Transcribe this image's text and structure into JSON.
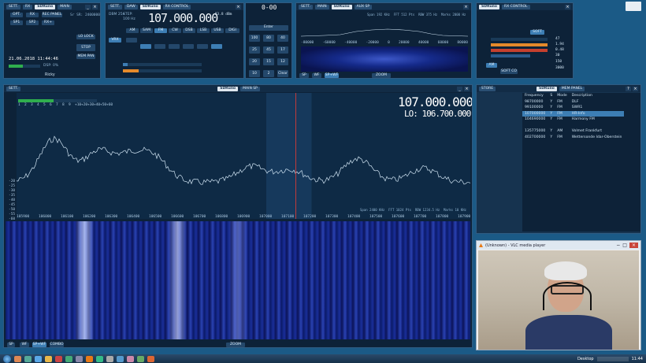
{
  "colors": {
    "desktop": "#1b5a86",
    "panel": "#0d2238",
    "accent": "#3d7eb4",
    "spectrum_trace": "#cfe3f2",
    "selected_row": "#3d7eb4"
  },
  "main_window": {
    "sett": "SETT.",
    "app": "SDRuno",
    "tab": "MAIN",
    "buttons": {
      "opt": "OPT.",
      "rx": "RX",
      "rec_panel": "REC PANEL",
      "sp1": "SP1",
      "sp2": "SP2",
      "rx_add": "RX+"
    },
    "sr": "Sr SR: 2400000",
    "lo_lock": "LO LOCK",
    "stop": "STOP",
    "mem_pan": "MEM PAN",
    "date": "21.06.2018 11:44:46",
    "cpu": "DSP: 0%",
    "user": "Ricky"
  },
  "rx_control": {
    "sett": "SETT.",
    "app": "SDRuno",
    "tab": "RX CONTROL",
    "bw_label": "DBM 25e",
    "step_label": "STEP:",
    "step_val": "100 Hz",
    "freq": "107.000.000",
    "level": "-83.8 dBm",
    "modes": [
      "AM",
      "SAM",
      "FM",
      "CW",
      "DSB",
      "LSB",
      "USB",
      "DIGI"
    ],
    "vrx": "VRX"
  },
  "keypad": {
    "keys": [
      "100",
      "80",
      "40",
      "25",
      "45",
      "17",
      "20",
      "15",
      "12",
      "10",
      "2",
      "Clear"
    ],
    "enter": "Enter",
    "display": "0-00"
  },
  "aux_sp": {
    "sett": "SETT.",
    "tab": "MAIN",
    "app": "SDRuno",
    "title": "AUX SP",
    "span": "Span 192 KHz",
    "fft": "FFT 512 Pts",
    "rbw": "RBW 375 Hz",
    "marks": "Marks 2000 Hz",
    "ticks": [
      "-80000",
      "-60000",
      "-40000",
      "-20000",
      "0",
      "20000",
      "40000",
      "60000",
      "80000"
    ],
    "zoom": "ZOOM",
    "bottom_btns": [
      "SP",
      "WF",
      "SP+WF"
    ]
  },
  "rx_ctrl_small": {
    "app": "SDRuno",
    "title": "RX CONTROL",
    "soft": "SOFT",
    "b1": "AM",
    "b2": "SOFT CO",
    "values": [
      "47",
      "1.94",
      "0.48",
      "30",
      "150",
      "3000"
    ]
  },
  "main_sp": {
    "sett": "SETT.",
    "app": "SDRuno",
    "title": "MAIN SP",
    "freq": "107.000.000",
    "lo": "LO: 106.700.000",
    "db_ticks": [
      "-20",
      "-25",
      "-30",
      "-35",
      "-40",
      "-45",
      "-50",
      "-55",
      "-60",
      "-65",
      "-70",
      "-75",
      "-80",
      "-85",
      "-90",
      "-95",
      "-100",
      "-105",
      "-110",
      "-115",
      "-120",
      "-125",
      "-130",
      "-135",
      "-140"
    ],
    "s_ticks": [
      "1",
      "2",
      "3",
      "4",
      "5",
      "6",
      "7",
      "8",
      "9",
      "+10",
      "+20",
      "+30",
      "+40",
      "+50",
      "+60"
    ],
    "freq_ticks": [
      "105900",
      "106000",
      "106100",
      "106200",
      "106300",
      "106400",
      "106500",
      "106600",
      "106700",
      "106800",
      "106900",
      "107000",
      "107100",
      "107200",
      "107300",
      "107400",
      "107500",
      "107600",
      "107700",
      "107800",
      "107900"
    ],
    "span": "Span 2400 KHz",
    "fft": "FFT 1024 Pts",
    "rbw": "RBW 1234.5 Hz",
    "marks": "Marks 10 KHz",
    "zoom": "ZOOM",
    "bottom_btns": [
      "SP",
      "WF",
      "SP+WF",
      "COMBO"
    ]
  },
  "memory_panel": {
    "app": "SDRuno",
    "title": "MEM PANEL",
    "headers": [
      "Frequency",
      "S",
      "Mode",
      "Description"
    ],
    "rows": [
      {
        "freq": "98700000",
        "s": "Y",
        "mode": "FM",
        "desc": "DLF",
        "sel": false
      },
      {
        "freq": "99100000",
        "s": "Y",
        "mode": "FM",
        "desc": "SWR1",
        "sel": false
      },
      {
        "freq": "107000000",
        "s": "Y",
        "mode": "FM",
        "desc": "HR-Info",
        "sel": true
      },
      {
        "freq": "104690000",
        "s": "Y",
        "mode": "FM",
        "desc": "Harmony FM",
        "sel": false
      },
      {
        "freq": "",
        "s": "",
        "mode": "",
        "desc": "",
        "sel": false
      },
      {
        "freq": "135775000",
        "s": "Y",
        "mode": "AM",
        "desc": "Volmet Frankfurt",
        "sel": false
      },
      {
        "freq": "402700000",
        "s": "Y",
        "mode": "FM",
        "desc": "Wettersonde Idar-Oberstein",
        "sel": false
      }
    ]
  },
  "vlc": {
    "title": "(Unknown) - VLC media player"
  },
  "taskbar": {
    "desktop": "Desktop",
    "time": "11:44"
  }
}
